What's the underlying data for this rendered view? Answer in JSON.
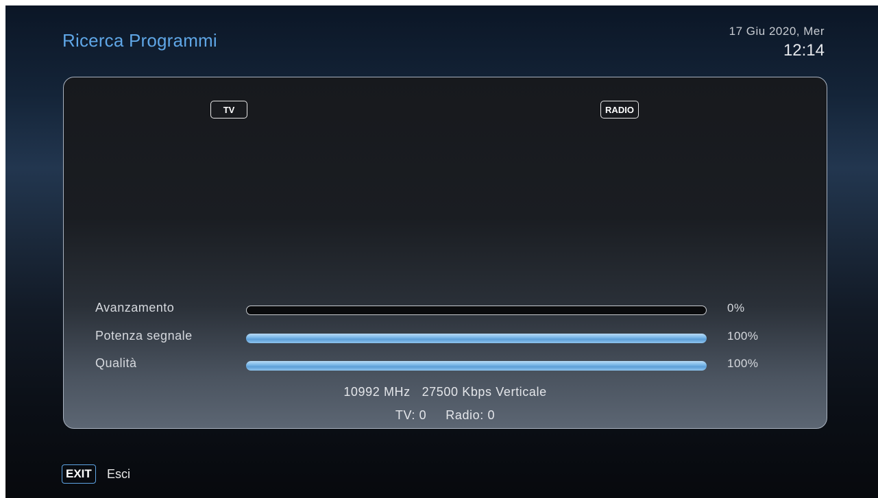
{
  "header": {
    "title": "Ricerca Programmi",
    "date": "17 Giu 2020, Mer",
    "time": "12:14"
  },
  "panel": {
    "tabs": [
      {
        "label": "TV"
      },
      {
        "label": "RADIO"
      }
    ],
    "rows": [
      {
        "label": "Avanzamento",
        "value_text": "0%",
        "progress": 0
      },
      {
        "label": "Potenza segnale",
        "value_text": "100%",
        "progress": 100
      },
      {
        "label": "Qualità",
        "value_text": "100%",
        "progress": 100
      }
    ],
    "transponder": "10992 MHz   27500 Kbps Verticale",
    "counts": "TV: 0     Radio: 0"
  },
  "footer": {
    "exit_key": "EXIT",
    "exit_label": "Esci"
  },
  "colors": {
    "accent": "#5fa6e6",
    "bar_fill": "#7cb8e8"
  }
}
